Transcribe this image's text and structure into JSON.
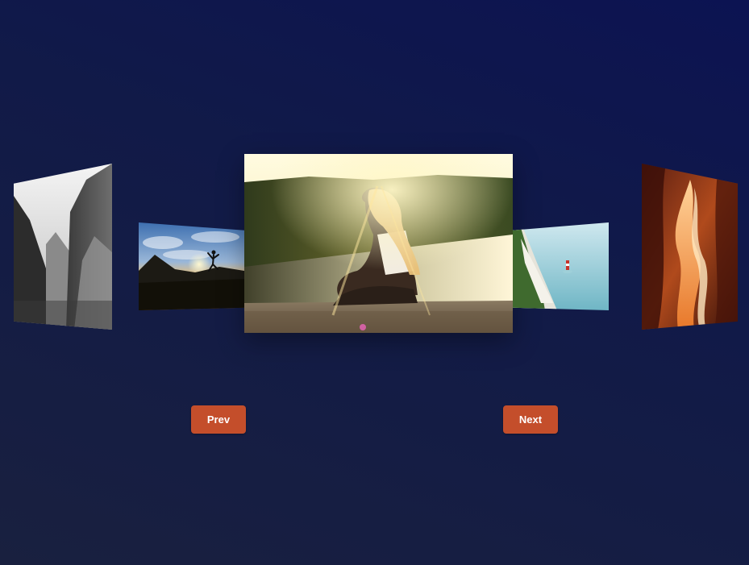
{
  "carousel": {
    "slides": [
      {
        "subject": "mountain-valley-grayscale"
      },
      {
        "subject": "person-jumping-at-sunset"
      },
      {
        "subject": "woman-sitting-by-lake-at-sunset"
      },
      {
        "subject": "white-cliffs-and-lighthouse"
      },
      {
        "subject": "slot-canyon"
      }
    ],
    "active_index": 2
  },
  "controls": {
    "prev_label": "Prev",
    "next_label": "Next"
  },
  "colors": {
    "button": "#c44e2b",
    "background_top": "#0c1352",
    "background_bottom": "#19203f"
  }
}
